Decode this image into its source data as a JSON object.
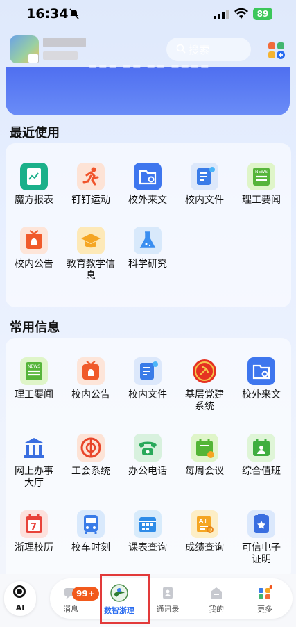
{
  "status": {
    "time": "16:34",
    "battery": "89"
  },
  "header": {
    "search_placeholder": "搜索"
  },
  "sections": {
    "recent": "最近使用",
    "common": "常用信息"
  },
  "recent_apps": [
    {
      "label": "魔方报表",
      "icon": "report-icon"
    },
    {
      "label": "钉钉运动",
      "icon": "running-icon"
    },
    {
      "label": "校外来文",
      "icon": "incoming-doc-icon"
    },
    {
      "label": "校内文件",
      "icon": "internal-file-icon"
    },
    {
      "label": "理工要闻",
      "icon": "news-icon"
    },
    {
      "label": "校内公告",
      "icon": "announcement-icon"
    },
    {
      "label": "教育教学信息",
      "icon": "education-icon"
    },
    {
      "label": "科学研究",
      "icon": "science-icon"
    }
  ],
  "common_apps": [
    {
      "label": "理工要闻",
      "icon": "news-icon"
    },
    {
      "label": "校内公告",
      "icon": "announcement-icon"
    },
    {
      "label": "校内文件",
      "icon": "internal-file-icon"
    },
    {
      "label": "基层党建系统",
      "icon": "party-icon"
    },
    {
      "label": "校外来文",
      "icon": "incoming-doc-icon"
    },
    {
      "label": "网上办事大厅",
      "icon": "hall-icon"
    },
    {
      "label": "工会系统",
      "icon": "union-icon"
    },
    {
      "label": "办公电话",
      "icon": "phone-icon"
    },
    {
      "label": "每周会议",
      "icon": "meeting-calendar-icon"
    },
    {
      "label": "综合值班",
      "icon": "duty-icon"
    },
    {
      "label": "浙理校历",
      "icon": "calendar-icon"
    },
    {
      "label": "校车时刻",
      "icon": "bus-icon"
    },
    {
      "label": "课表查询",
      "icon": "timetable-icon"
    },
    {
      "label": "成绩查询",
      "icon": "grades-icon"
    },
    {
      "label": "可信电子证明",
      "icon": "certificate-icon"
    }
  ],
  "tabbar": {
    "ai": "AI",
    "messages": "消息",
    "messages_badge": "99+",
    "home": "数智浙理",
    "contacts": "通讯录",
    "mine": "我的",
    "more": "更多"
  }
}
